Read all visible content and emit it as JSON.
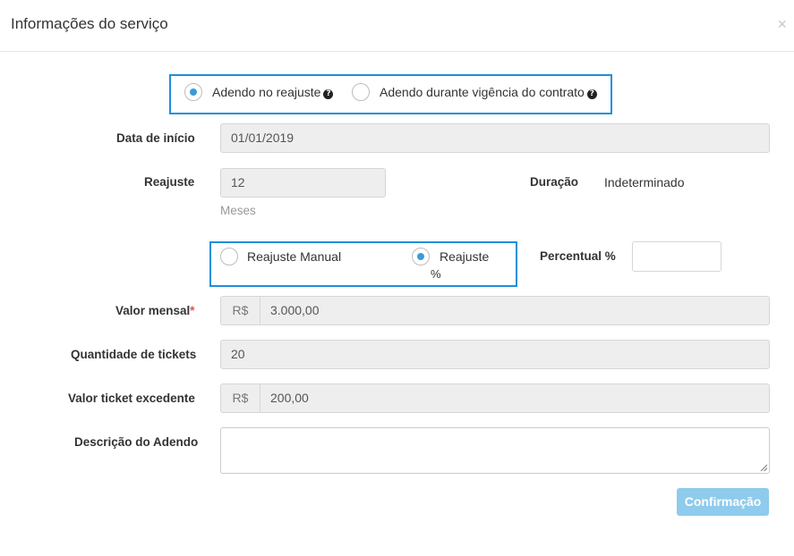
{
  "modal": {
    "title": "Informações do serviço",
    "close_glyph": "×"
  },
  "adendo_type": {
    "options": [
      {
        "label": "Adendo no reajuste",
        "selected": true,
        "help_icon": "question-circle-icon"
      },
      {
        "label": "Adendo durante vigência do contrato",
        "selected": false,
        "help_icon": "question-circle-icon"
      }
    ]
  },
  "form": {
    "data_inicio": {
      "label": "Data de início",
      "value": "01/01/2019"
    },
    "reajuste": {
      "label": "Reajuste",
      "value": "12",
      "help": "Meses"
    },
    "duracao": {
      "label": "Duração",
      "value": "Indeterminado"
    },
    "reajuste_mode": {
      "options": [
        {
          "label": "Reajuste Manual",
          "selected": false
        },
        {
          "label_line1": "Reajuste",
          "label_line2": "%",
          "selected": true
        }
      ]
    },
    "percentual": {
      "label": "Percentual %",
      "value": ""
    },
    "valor_mensal": {
      "label": "Valor mensal",
      "required_mark": "*",
      "currency": "R$",
      "value": "3.000,00"
    },
    "quantidade_tickets": {
      "label": "Quantidade de tickets",
      "value": "20"
    },
    "valor_ticket_excedente": {
      "label": "Valor ticket excedente",
      "currency": "R$",
      "value": "200,00"
    },
    "descricao_adendo": {
      "label": "Descrição do Adendo",
      "value": ""
    }
  },
  "actions": {
    "confirm_label": "Confirmação"
  },
  "colors": {
    "highlight_border": "#1e90d9",
    "radio_selected": "#3a9bd9",
    "button_bg": "#8ecbec",
    "required": "#d9534f"
  }
}
